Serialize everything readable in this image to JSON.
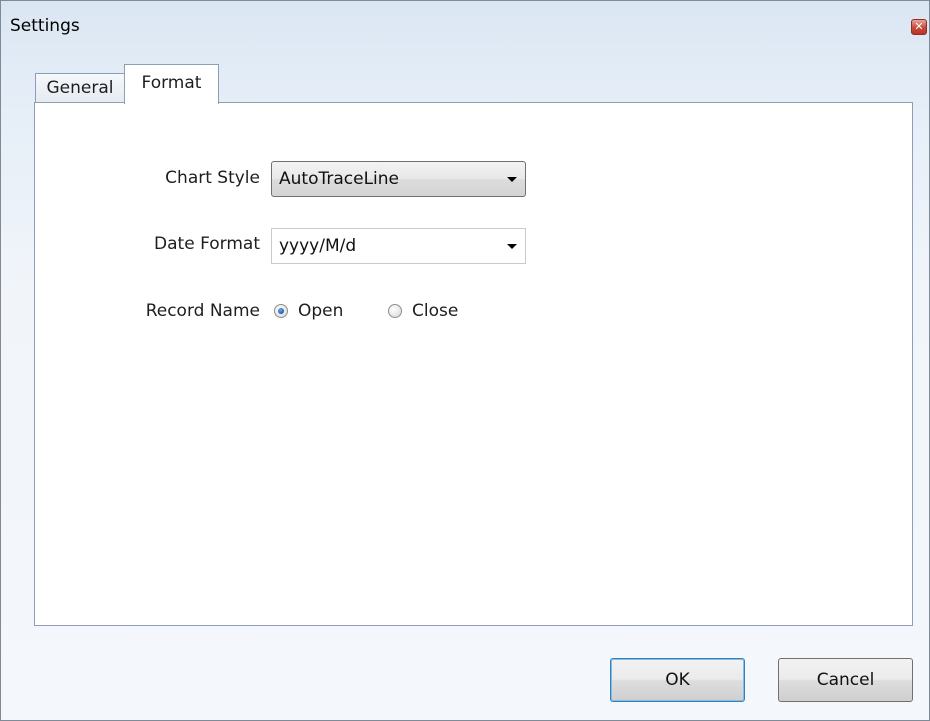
{
  "window": {
    "title": "Settings",
    "close_glyph": "✕"
  },
  "tabs": [
    {
      "label": "General",
      "selected": false
    },
    {
      "label": "Format",
      "selected": true
    }
  ],
  "format": {
    "chart_style": {
      "label": "Chart Style",
      "value": "AutoTraceLine"
    },
    "date_format": {
      "label": "Date Format",
      "value": "yyyy/M/d"
    },
    "record_name": {
      "label": "Record Name",
      "options": [
        {
          "label": "Open",
          "checked": true
        },
        {
          "label": "Close",
          "checked": false
        }
      ]
    }
  },
  "buttons": {
    "ok": "OK",
    "cancel": "Cancel"
  },
  "icons": {
    "close": "close-icon",
    "dropdown": "chevron-down-icon",
    "radio": "radio-icon"
  },
  "colors": {
    "default_button_border": "#3c7fb1",
    "close_button": "#c9483a",
    "radio_selected": "#1b5fae"
  }
}
